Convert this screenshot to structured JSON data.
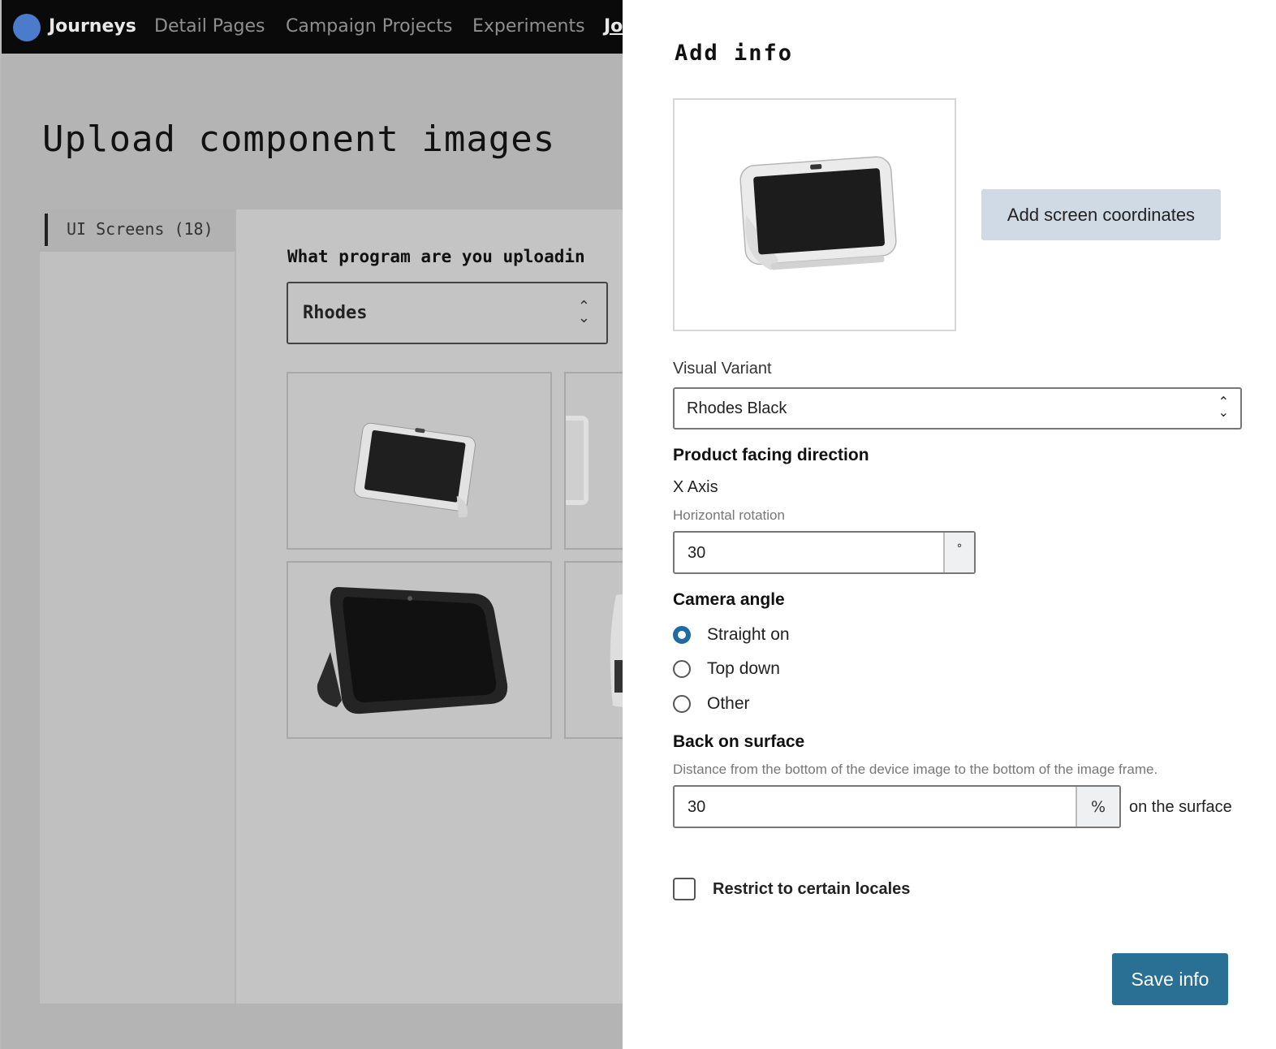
{
  "nav": {
    "items": [
      "Journeys",
      "Detail Pages",
      "Campaign Projects",
      "Experiments",
      "Jo"
    ]
  },
  "background_page": {
    "title": "Upload component images",
    "side_tab": "UI Screens (18)",
    "question": "What program are you uploadin",
    "program_select": {
      "value": "Rhodes"
    }
  },
  "drawer": {
    "title": "Add info",
    "add_coords_button": "Add screen coordinates",
    "visual_variant": {
      "label": "Visual Variant",
      "value": "Rhodes Black"
    },
    "facing": {
      "heading": "Product facing direction",
      "axis_label": "X Axis",
      "help": "Horizontal rotation",
      "value": "30",
      "unit": "°"
    },
    "camera": {
      "heading": "Camera angle",
      "options": [
        "Straight on",
        "Top down",
        "Other"
      ],
      "selected": "Straight on"
    },
    "surface": {
      "heading": "Back on surface",
      "help": "Distance from the bottom of the device image to the bottom of the image frame.",
      "value": "30",
      "unit": "%",
      "suffix": "on the surface"
    },
    "locale_checkbox": {
      "label": "Restrict to certain locales",
      "checked": false
    },
    "save_button": "Save info"
  },
  "colors": {
    "primary": "#2a6f94",
    "secondary_button": "#d0dae4",
    "radio_checked": "#1e6aa3",
    "overlay": "#b4b4b4",
    "nav_bg": "#0a0a0a",
    "logo": "#4b7ccc"
  },
  "icons": {
    "logo": "circle-logo",
    "select_chevron": "up-down-chevron-icon"
  }
}
